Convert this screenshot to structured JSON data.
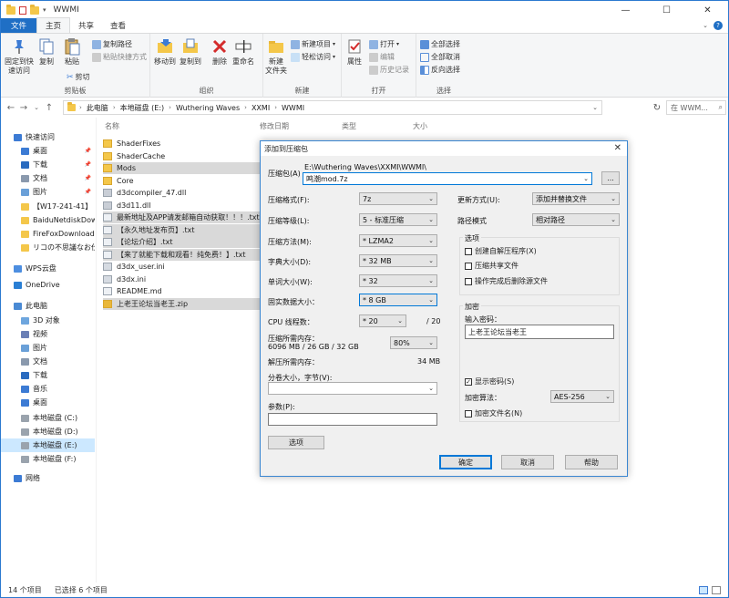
{
  "window": {
    "title": "WWMI"
  },
  "tabs": [
    {
      "label": "文件"
    },
    {
      "label": "主页"
    },
    {
      "label": "共享"
    },
    {
      "label": "查看"
    }
  ],
  "ribbon": {
    "clipboard": {
      "label": "剪贴板",
      "pin": "固定到快\n速访问",
      "copy": "复制",
      "paste": "粘贴",
      "copy_path": "复制路径",
      "paste_shortcut": "粘贴快捷方式",
      "cut": "剪切"
    },
    "organize": {
      "label": "组织",
      "move_to": "移动到",
      "copy_to": "复制到",
      "delete": "删除",
      "rename": "重命名"
    },
    "new": {
      "label": "新建",
      "new_folder": "新建\n文件夹",
      "new_item": "新建项目",
      "easy_access": "轻松访问"
    },
    "open": {
      "label": "打开",
      "properties": "属性",
      "open": "打开",
      "edit": "编辑",
      "history": "历史记录"
    },
    "select": {
      "label": "选择",
      "select_all": "全部选择",
      "select_none": "全部取消",
      "invert": "反向选择"
    }
  },
  "address": {
    "crumbs": [
      "此电脑",
      "本地磁盘 (E:)",
      "Wuthering Waves",
      "XXMI",
      "WWMI"
    ],
    "search_placeholder": "在 WWM..."
  },
  "sidebar": {
    "items": [
      {
        "label": "快速访问",
        "icon": "star-icon"
      },
      {
        "label": "桌面",
        "icon": "desktop-icon"
      },
      {
        "label": "下载",
        "icon": "download-icon"
      },
      {
        "label": "文档",
        "icon": "document-icon"
      },
      {
        "label": "图片",
        "icon": "picture-icon"
      },
      {
        "label": "【W17-241-41】",
        "icon": "folder-icon"
      },
      {
        "label": "BaiduNetdiskDow",
        "icon": "folder-icon"
      },
      {
        "label": "FireFoxDownload",
        "icon": "folder-icon"
      },
      {
        "label": "リコの不思議なお仕",
        "icon": "folder-icon"
      },
      {
        "label": "WPS云盘",
        "icon": "cloud-icon"
      },
      {
        "label": "OneDrive",
        "icon": "onedrive-icon"
      },
      {
        "label": "此电脑",
        "icon": "pc-icon"
      },
      {
        "label": "3D 对象",
        "icon": "3d-icon"
      },
      {
        "label": "视频",
        "icon": "video-icon"
      },
      {
        "label": "图片",
        "icon": "picture-icon"
      },
      {
        "label": "文档",
        "icon": "document-icon"
      },
      {
        "label": "下载",
        "icon": "download-icon"
      },
      {
        "label": "音乐",
        "icon": "music-icon"
      },
      {
        "label": "桌面",
        "icon": "desktop-icon"
      },
      {
        "label": "本地磁盘 (C:)",
        "icon": "drive-icon"
      },
      {
        "label": "本地磁盘 (D:)",
        "icon": "drive-icon"
      },
      {
        "label": "本地磁盘 (E:)",
        "icon": "drive-icon"
      },
      {
        "label": "本地磁盘 (F:)",
        "icon": "drive-icon"
      },
      {
        "label": "网络",
        "icon": "network-icon"
      }
    ]
  },
  "columns": {
    "name": "名称",
    "date": "修改日期",
    "type": "类型",
    "size": "大小"
  },
  "files": [
    {
      "name": "ShaderFixes",
      "icon": "folder-icon"
    },
    {
      "name": "ShaderCache",
      "icon": "folder-icon"
    },
    {
      "name": "Mods",
      "icon": "folder-icon"
    },
    {
      "name": "Core",
      "icon": "folder-icon"
    },
    {
      "name": "d3dcompiler_47.dll",
      "icon": "dll-icon"
    },
    {
      "name": "d3d11.dll",
      "icon": "dll-icon"
    },
    {
      "name": "最新地址及APP请发邮箱自动获取！！！.txt",
      "icon": "txt-icon"
    },
    {
      "name": "【永久地址发布页】.txt",
      "icon": "txt-icon"
    },
    {
      "name": "【论坛介绍】.txt",
      "icon": "txt-icon"
    },
    {
      "name": "【来了就能下载和观看！纯免费！】.txt",
      "icon": "txt-icon"
    },
    {
      "name": "d3dx_user.ini",
      "icon": "ini-icon"
    },
    {
      "name": "d3dx.ini",
      "icon": "ini-icon"
    },
    {
      "name": "README.md",
      "icon": "md-icon"
    },
    {
      "name": "上老王论坛当老王.zip",
      "icon": "zip-icon"
    }
  ],
  "status": {
    "count": "14 个项目",
    "selected": "已选择 6 个项目"
  },
  "dialog": {
    "title": "添加到压缩包",
    "archive_label": "压缩包(A)",
    "archive_path": "E:\\Wuthering Waves\\XXMI\\WWMI\\",
    "archive_name": "鸣潮mod.7z",
    "browse": "...",
    "format_label": "压缩格式(F):",
    "format": "7z",
    "level_label": "压缩等级(L):",
    "level": "5 - 标准压缩",
    "method_label": "压缩方法(M):",
    "method": "* LZMA2",
    "dict_label": "字典大小(D):",
    "dict": "* 32 MB",
    "word_label": "单词大小(W):",
    "word": "* 32",
    "solid_label": "固实数据大小：",
    "solid": "* 8 GB",
    "threads_label": "CPU 线程数：",
    "threads": "* 20",
    "threads_max": "/ 20",
    "mem_label": "压缩所需内存：",
    "mem_value": "6096 MB / 26 GB / 32 GB",
    "mem_pct": "80%",
    "decomp_label": "解压所需内存：",
    "decomp_value": "34 MB",
    "split_label": "分卷大小，字节(V):",
    "params_label": "参数(P):",
    "options_btn": "选项",
    "update_label": "更新方式(U):",
    "update": "添加并替换文件",
    "pathmode_label": "路径模式",
    "pathmode": "相对路径",
    "opts_title": "选项",
    "opt_sfx": "创建自解压程序(X)",
    "opt_shared": "压缩共享文件",
    "opt_delete": "操作完成后删除源文件",
    "enc_title": "加密",
    "pwd_label": "输入密码：",
    "pwd": "上老王论坛当老王",
    "show_pwd": "显示密码(S)",
    "enc_method_label": "加密算法：",
    "enc_method": "AES-256",
    "enc_names": "加密文件名(N)",
    "ok": "确定",
    "cancel": "取消",
    "help": "帮助"
  }
}
